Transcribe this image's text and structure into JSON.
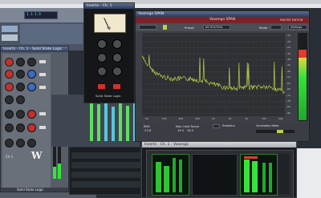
{
  "host": {
    "title": "Cubase",
    "transport_clock": "1. 1. 1. 0",
    "mixer_channels": 14
  },
  "eq_plugin": {
    "title": "Inserts - Ch. 1 - Solid State Logic",
    "channel_label": "Ch 1",
    "brand": "W",
    "footer": "Solid State Logic"
  },
  "compressor_plugin": {
    "title": "Inserts - Ch. 1",
    "brand": "Solid State Logic",
    "meter_label": "GR"
  },
  "span_plugin": {
    "title": "Voxengo SPAN",
    "brand": "Voxengo SPAN",
    "edition": "MASTER EDITION",
    "preset_label": "Preset",
    "settings_label": "Settings",
    "mode_label": "Mode",
    "routing_value": "NO ROUTING",
    "statistics_label": "Statistics",
    "correlation_label": "Correlation Meter",
    "rms_label": "RMS",
    "peak_label": "Max Crest Factor",
    "rms_value": "-23.6",
    "peak_values": [
      "19.9",
      "16.5"
    ],
    "freq_axis": [
      "50",
      "100",
      "200",
      "500",
      "1k",
      "2k",
      "5k",
      "10k",
      "20k"
    ],
    "db_axis": [
      "-12",
      "-18",
      "-24",
      "-30",
      "-36",
      "-42",
      "-48",
      "-54",
      "-60",
      "-66",
      "-72",
      "-78",
      "-84",
      "-90"
    ]
  },
  "meter_plugin": {
    "title": "Inserts - Ch. 1 - Voxengo"
  },
  "colors": {
    "spectrum_line": "#b9d24a",
    "spectrum_bg": "#2d2f33",
    "span_header": "#7a2227",
    "meter_green": "#36e33a",
    "meter_red": "#e43a2f",
    "eq_red": "#c2322c",
    "eq_blue": "#3b6cc2"
  }
}
